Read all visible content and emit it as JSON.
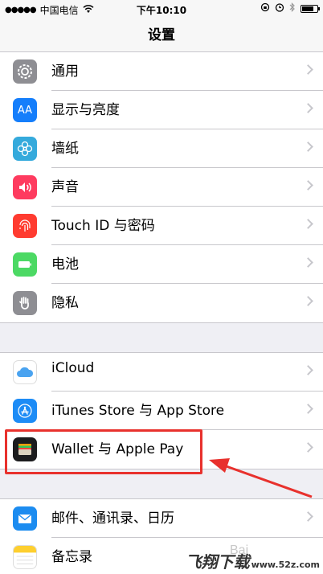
{
  "status_bar": {
    "signal": "●●●●●",
    "carrier": "中国电信",
    "time": "下午10:10"
  },
  "nav": {
    "title": "设置"
  },
  "groups": [
    {
      "rows": [
        {
          "label": "通用",
          "icon": "gear-icon",
          "color": "#8e8e93"
        },
        {
          "label": "显示与亮度",
          "icon": "aa-icon",
          "icon_text": "AA",
          "color": "#157efb"
        },
        {
          "label": "墙纸",
          "icon": "flower-icon",
          "color": "#35aadc"
        },
        {
          "label": "声音",
          "icon": "speaker-icon",
          "color": "#fe3b5f"
        },
        {
          "label": "Touch ID 与密码",
          "icon": "fingerprint-icon",
          "color": "#ff3b30"
        },
        {
          "label": "电池",
          "icon": "battery-icon",
          "color": "#4cd964"
        },
        {
          "label": "隐私",
          "icon": "hand-icon",
          "color": "#8e8e93"
        }
      ]
    },
    {
      "rows": [
        {
          "label": "iCloud",
          "icon": "cloud-icon",
          "color": "#ffffff"
        },
        {
          "label": "iTunes Store 与 App Store",
          "icon": "app-store-icon",
          "color": "#1d8cf6"
        },
        {
          "label": "Wallet 与 Apple Pay",
          "icon": "wallet-icon",
          "color": "#1c1c1e"
        }
      ]
    },
    {
      "rows": [
        {
          "label": "邮件、通讯录、日历",
          "icon": "mail-icon",
          "color": "#1c8cf0"
        },
        {
          "label": "备忘录",
          "icon": "notes-icon",
          "color": "#ffffff"
        }
      ]
    }
  ],
  "watermark": {
    "brand": "飞翔下载",
    "url": "www.52z.com",
    "baidu": "Bai"
  }
}
